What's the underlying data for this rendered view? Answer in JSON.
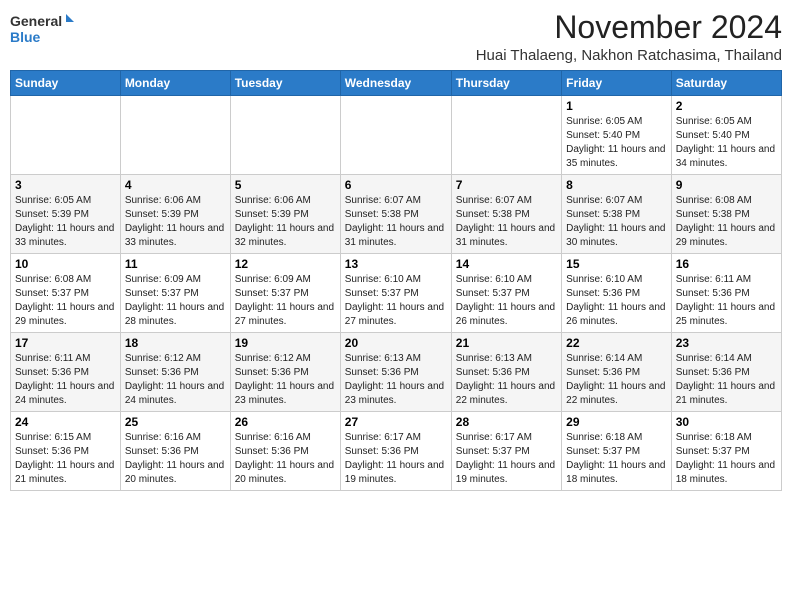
{
  "header": {
    "logo_line1": "General",
    "logo_line2": "Blue",
    "month": "November 2024",
    "location": "Huai Thalaeng, Nakhon Ratchasima, Thailand"
  },
  "weekdays": [
    "Sunday",
    "Monday",
    "Tuesday",
    "Wednesday",
    "Thursday",
    "Friday",
    "Saturday"
  ],
  "weeks": [
    [
      {
        "day": "",
        "info": ""
      },
      {
        "day": "",
        "info": ""
      },
      {
        "day": "",
        "info": ""
      },
      {
        "day": "",
        "info": ""
      },
      {
        "day": "",
        "info": ""
      },
      {
        "day": "1",
        "info": "Sunrise: 6:05 AM\nSunset: 5:40 PM\nDaylight: 11 hours and 35 minutes."
      },
      {
        "day": "2",
        "info": "Sunrise: 6:05 AM\nSunset: 5:40 PM\nDaylight: 11 hours and 34 minutes."
      }
    ],
    [
      {
        "day": "3",
        "info": "Sunrise: 6:05 AM\nSunset: 5:39 PM\nDaylight: 11 hours and 33 minutes."
      },
      {
        "day": "4",
        "info": "Sunrise: 6:06 AM\nSunset: 5:39 PM\nDaylight: 11 hours and 33 minutes."
      },
      {
        "day": "5",
        "info": "Sunrise: 6:06 AM\nSunset: 5:39 PM\nDaylight: 11 hours and 32 minutes."
      },
      {
        "day": "6",
        "info": "Sunrise: 6:07 AM\nSunset: 5:38 PM\nDaylight: 11 hours and 31 minutes."
      },
      {
        "day": "7",
        "info": "Sunrise: 6:07 AM\nSunset: 5:38 PM\nDaylight: 11 hours and 31 minutes."
      },
      {
        "day": "8",
        "info": "Sunrise: 6:07 AM\nSunset: 5:38 PM\nDaylight: 11 hours and 30 minutes."
      },
      {
        "day": "9",
        "info": "Sunrise: 6:08 AM\nSunset: 5:38 PM\nDaylight: 11 hours and 29 minutes."
      }
    ],
    [
      {
        "day": "10",
        "info": "Sunrise: 6:08 AM\nSunset: 5:37 PM\nDaylight: 11 hours and 29 minutes."
      },
      {
        "day": "11",
        "info": "Sunrise: 6:09 AM\nSunset: 5:37 PM\nDaylight: 11 hours and 28 minutes."
      },
      {
        "day": "12",
        "info": "Sunrise: 6:09 AM\nSunset: 5:37 PM\nDaylight: 11 hours and 27 minutes."
      },
      {
        "day": "13",
        "info": "Sunrise: 6:10 AM\nSunset: 5:37 PM\nDaylight: 11 hours and 27 minutes."
      },
      {
        "day": "14",
        "info": "Sunrise: 6:10 AM\nSunset: 5:37 PM\nDaylight: 11 hours and 26 minutes."
      },
      {
        "day": "15",
        "info": "Sunrise: 6:10 AM\nSunset: 5:36 PM\nDaylight: 11 hours and 26 minutes."
      },
      {
        "day": "16",
        "info": "Sunrise: 6:11 AM\nSunset: 5:36 PM\nDaylight: 11 hours and 25 minutes."
      }
    ],
    [
      {
        "day": "17",
        "info": "Sunrise: 6:11 AM\nSunset: 5:36 PM\nDaylight: 11 hours and 24 minutes."
      },
      {
        "day": "18",
        "info": "Sunrise: 6:12 AM\nSunset: 5:36 PM\nDaylight: 11 hours and 24 minutes."
      },
      {
        "day": "19",
        "info": "Sunrise: 6:12 AM\nSunset: 5:36 PM\nDaylight: 11 hours and 23 minutes."
      },
      {
        "day": "20",
        "info": "Sunrise: 6:13 AM\nSunset: 5:36 PM\nDaylight: 11 hours and 23 minutes."
      },
      {
        "day": "21",
        "info": "Sunrise: 6:13 AM\nSunset: 5:36 PM\nDaylight: 11 hours and 22 minutes."
      },
      {
        "day": "22",
        "info": "Sunrise: 6:14 AM\nSunset: 5:36 PM\nDaylight: 11 hours and 22 minutes."
      },
      {
        "day": "23",
        "info": "Sunrise: 6:14 AM\nSunset: 5:36 PM\nDaylight: 11 hours and 21 minutes."
      }
    ],
    [
      {
        "day": "24",
        "info": "Sunrise: 6:15 AM\nSunset: 5:36 PM\nDaylight: 11 hours and 21 minutes."
      },
      {
        "day": "25",
        "info": "Sunrise: 6:16 AM\nSunset: 5:36 PM\nDaylight: 11 hours and 20 minutes."
      },
      {
        "day": "26",
        "info": "Sunrise: 6:16 AM\nSunset: 5:36 PM\nDaylight: 11 hours and 20 minutes."
      },
      {
        "day": "27",
        "info": "Sunrise: 6:17 AM\nSunset: 5:36 PM\nDaylight: 11 hours and 19 minutes."
      },
      {
        "day": "28",
        "info": "Sunrise: 6:17 AM\nSunset: 5:37 PM\nDaylight: 11 hours and 19 minutes."
      },
      {
        "day": "29",
        "info": "Sunrise: 6:18 AM\nSunset: 5:37 PM\nDaylight: 11 hours and 18 minutes."
      },
      {
        "day": "30",
        "info": "Sunrise: 6:18 AM\nSunset: 5:37 PM\nDaylight: 11 hours and 18 minutes."
      }
    ]
  ]
}
